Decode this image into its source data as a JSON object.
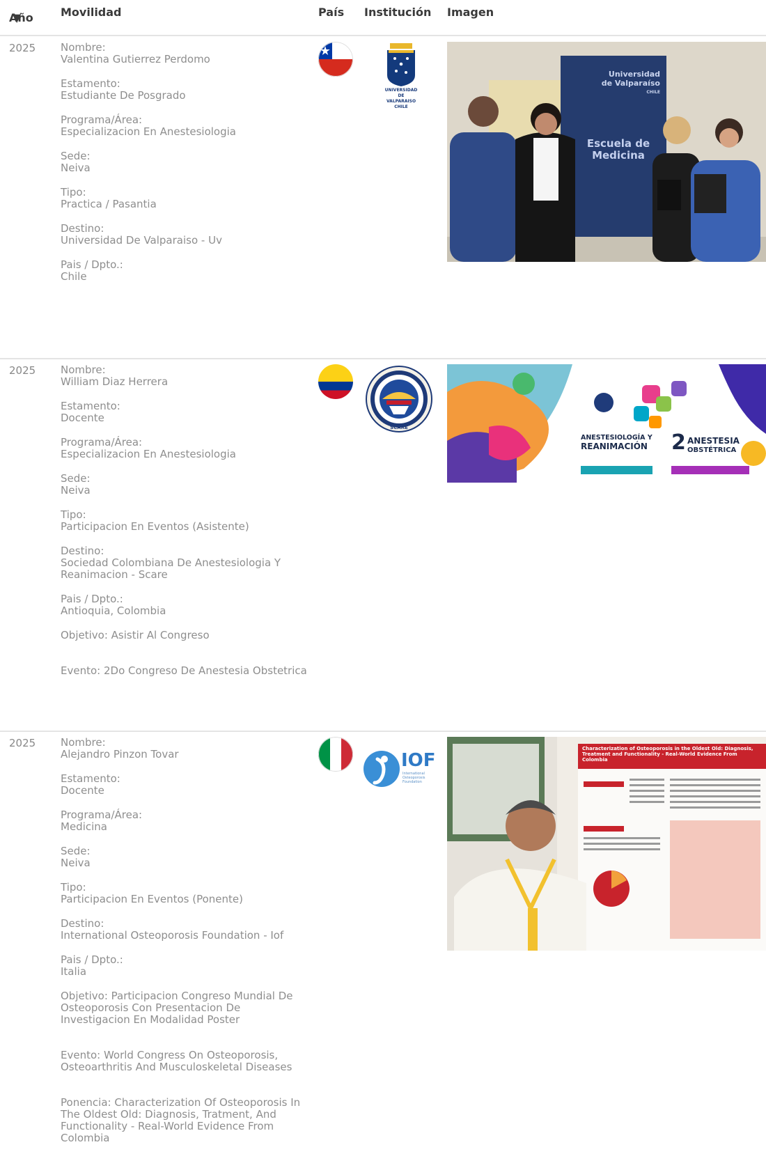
{
  "table": {
    "headers": {
      "year": "Año",
      "mobility": "Movilidad",
      "country": "País",
      "institution": "Institución",
      "image": "Imagen"
    }
  },
  "rows": [
    {
      "year": "2025",
      "fields": [
        {
          "k": "Nombre:",
          "v": "Valentina Gutierrez Perdomo"
        },
        {
          "k": "Estamento:",
          "v": "Estudiante De Posgrado"
        },
        {
          "k": "Programa/Área:",
          "v": "Especializacion En Anestesiologia"
        },
        {
          "k": "Sede:",
          "v": "Neiva"
        },
        {
          "k": "Tipo:",
          "v": "Practica / Pasantia"
        },
        {
          "k": "Destino:",
          "v": "Universidad De Valparaiso - Uv"
        },
        {
          "k": "Pais / Dpto.:",
          "v": "Chile"
        }
      ],
      "flag": "chile-flag-icon",
      "institution_logo": {
        "icon": "universidad-de-valparaiso-logo",
        "text": [
          "UNIVERSIDAD",
          "DE",
          "VALPARAISO",
          "CHILE"
        ]
      },
      "photo": {
        "banner_lines": [
          "Universidad",
          "de Valparaíso",
          "CHILE"
        ],
        "banner_title": [
          "Escuela de",
          "Medicina"
        ]
      }
    },
    {
      "year": "2025",
      "fields": [
        {
          "k": "Nombre:",
          "v": "William Diaz Herrera"
        },
        {
          "k": "Estamento:",
          "v": "Docente"
        },
        {
          "k": "Programa/Área:",
          "v": "Especializacion En Anestesiologia"
        },
        {
          "k": "Sede:",
          "v": "Neiva"
        },
        {
          "k": "Tipo:",
          "v": "Participacion En Eventos (Asistente)"
        },
        {
          "k": "Destino:",
          "v": "Sociedad Colombiana De Anestesiologia Y Reanimacion - Scare"
        },
        {
          "k": "Pais / Dpto.:",
          "v": "Antioquia, Colombia"
        }
      ],
      "extras": [
        {
          "text": "Objetivo: Asistir Al Congreso"
        },
        {
          "text": "Evento: 2Do Congreso De Anestesia Obstetrica"
        }
      ],
      "flag": "colombia-flag-icon",
      "institution_logo": {
        "icon": "scare-seal-logo",
        "text": [
          "SCARE"
        ]
      },
      "photo": {
        "lines": [
          "ANESTESIOLOGÍA Y",
          "REANIMACIÓN"
        ],
        "num": "2",
        "lines2": [
          "ANESTESIA",
          "OBSTÉTRICA"
        ]
      }
    },
    {
      "year": "2025",
      "fields": [
        {
          "k": "Nombre:",
          "v": "Alejandro Pinzon Tovar"
        },
        {
          "k": "Estamento:",
          "v": "Docente"
        },
        {
          "k": "Programa/Área:",
          "v": "Medicina"
        },
        {
          "k": "Sede:",
          "v": "Neiva"
        },
        {
          "k": "Tipo:",
          "v": "Participacion En Eventos (Ponente)"
        },
        {
          "k": "Destino:",
          "v": "International Osteoporosis Foundation - Iof"
        },
        {
          "k": "Pais / Dpto.:",
          "v": "Italia"
        }
      ],
      "extras": [
        {
          "text": "Objetivo: Participacion Congreso Mundial De Osteoporosis Con Presentacion De Investigacion En Modalidad Poster"
        },
        {
          "text": "Evento: World Congress On Osteoporosis, Osteoarthritis And Musculoskeletal Diseases"
        },
        {
          "text": "Ponencia: Characterization Of Osteoporosis In The Oldest Old: Diagnosis, Tratment, And Functionality - Real-World Evidence From Colombia"
        }
      ],
      "flag": "italy-flag-icon",
      "institution_logo": {
        "icon": "iof-logo",
        "text": [
          "IOF",
          "International",
          "Osteoporosis",
          "Foundation"
        ]
      },
      "photo": {
        "poster_title": "Characterization of Osteoporosis in the Oldest Old: Diagnosis, Treatment and Functionality - Real-World Evidence From Colombia"
      }
    }
  ]
}
